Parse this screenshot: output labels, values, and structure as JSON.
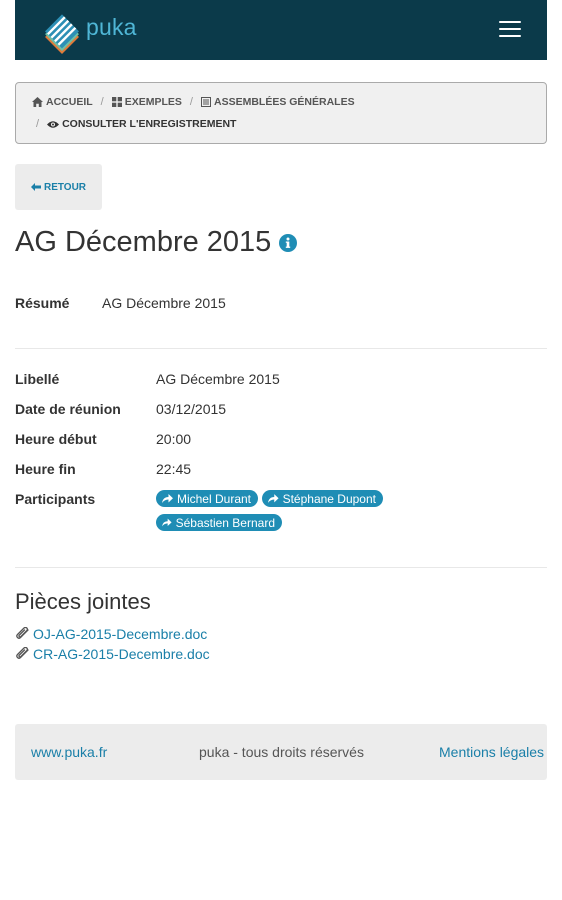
{
  "navbar": {
    "logo_text": "puka",
    "menu_icon": "hamburger-menu-icon"
  },
  "breadcrumb": {
    "items": [
      {
        "label": "ACCUEIL",
        "icon": "home-icon"
      },
      {
        "label": "EXEMPLES",
        "icon": "grid-icon"
      },
      {
        "label": "ASSEMBLÉES GÉNÉRALES",
        "icon": "list-icon"
      }
    ],
    "current": {
      "label": "CONSULTER L'ENREGISTREMENT",
      "icon": "eye-icon"
    },
    "separator": "/"
  },
  "back_button": {
    "label": "RETOUR",
    "icon": "arrow-left-icon"
  },
  "page": {
    "title": "AG Décembre 2015",
    "title_icon": "info-circle-icon"
  },
  "summary": {
    "label": "Résumé",
    "value": "AG Décembre 2015"
  },
  "details": {
    "libelle": {
      "label": "Libellé",
      "value": "AG Décembre 2015"
    },
    "date": {
      "label": "Date de réunion",
      "value": "03/12/2015"
    },
    "heure_debut": {
      "label": "Heure début",
      "value": "20:00"
    },
    "heure_fin": {
      "label": "Heure fin",
      "value": "22:45"
    },
    "participants": {
      "label": "Participants",
      "items": [
        "Michel Durant",
        "Stéphane Dupont",
        "Sébastien Bernard"
      ],
      "icon": "share-arrow-icon"
    }
  },
  "attachments": {
    "title": "Pièces jointes",
    "icon": "paperclip-icon",
    "files": [
      "OJ-AG-2015-Decembre.doc",
      "CR-AG-2015-Decembre.doc"
    ]
  },
  "footer": {
    "left_link": "www.puka.fr",
    "center_text": "puka - tous droits réservés",
    "right_link": "Mentions légales"
  },
  "colors": {
    "navbar_bg": "#0b3a4a",
    "link": "#1a7fa8",
    "tag_bg": "#1f8db5",
    "logo_text": "#4fb6d6"
  }
}
